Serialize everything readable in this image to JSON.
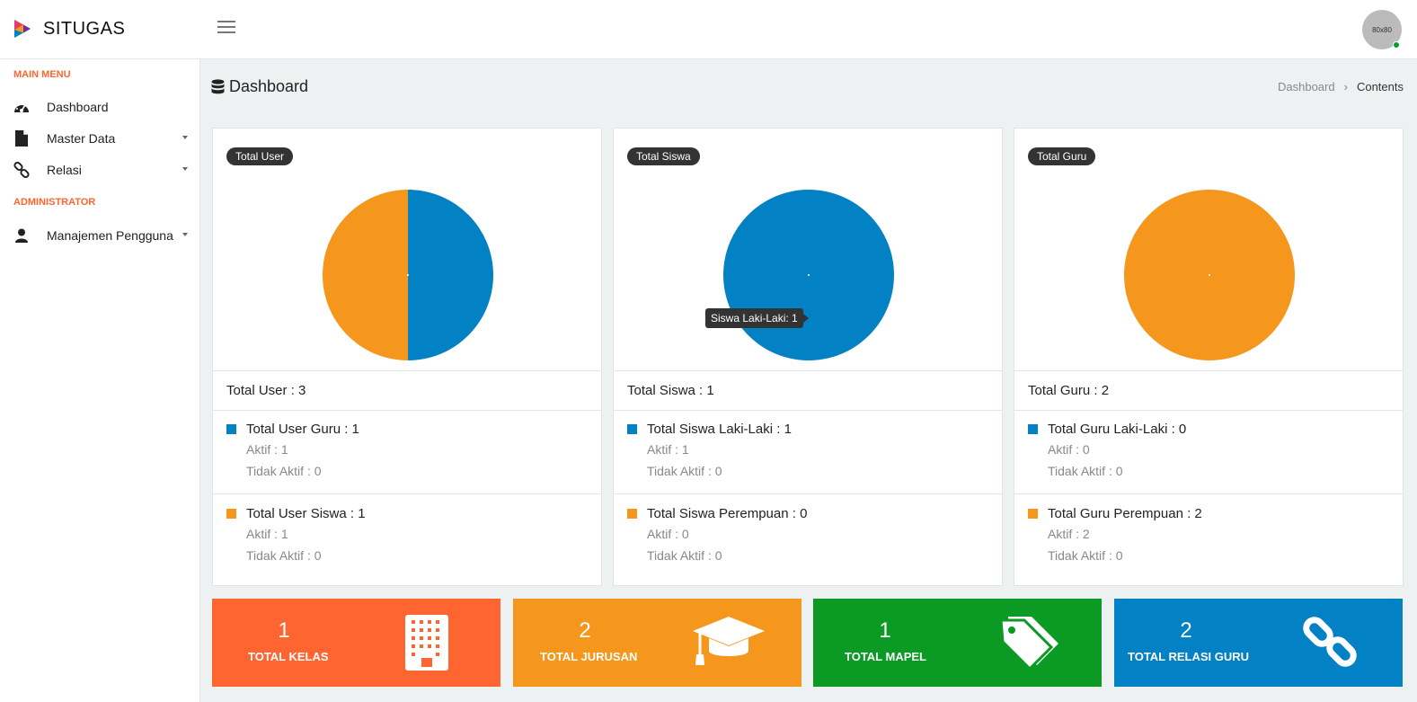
{
  "app": {
    "name": "SITUGAS"
  },
  "header": {
    "avatar_text": "80x80"
  },
  "sidebar": {
    "sections": [
      {
        "header": "MAIN MENU"
      },
      {
        "header": "ADMINISTRATOR"
      }
    ],
    "items": [
      {
        "label": "Dashboard",
        "icon": "dashboard-icon"
      },
      {
        "label": "Master Data",
        "icon": "file-icon"
      },
      {
        "label": "Relasi",
        "icon": "link-icon"
      },
      {
        "label": "Manajemen Pengguna",
        "icon": "user-icon"
      }
    ]
  },
  "page": {
    "title": "Dashboard"
  },
  "breadcrumb": {
    "items": [
      "Dashboard",
      "Contents"
    ]
  },
  "colors": {
    "blue": "#0281c4",
    "orange": "#f5971d",
    "red": "#ff6530",
    "green": "#0b9a24"
  },
  "cards": [
    {
      "pill": "Total User",
      "total": "Total User : 3",
      "groups": [
        {
          "title": "Total User Guru : 1",
          "aktif": "Aktif : 1",
          "tidak_aktif": "Tidak Aktif : 0"
        },
        {
          "title": "Total User Siswa : 1",
          "aktif": "Aktif : 1",
          "tidak_aktif": "Tidak Aktif : 0"
        }
      ]
    },
    {
      "pill": "Total Siswa",
      "total": "Total Siswa : 1",
      "tooltip": "Siswa Laki-Laki: 1",
      "groups": [
        {
          "title": "Total Siswa Laki-Laki : 1",
          "aktif": "Aktif : 1",
          "tidak_aktif": "Tidak Aktif : 0"
        },
        {
          "title": "Total Siswa Perempuan : 0",
          "aktif": "Aktif : 0",
          "tidak_aktif": "Tidak Aktif : 0"
        }
      ]
    },
    {
      "pill": "Total Guru",
      "total": "Total Guru : 2",
      "groups": [
        {
          "title": "Total Guru Laki-Laki : 0",
          "aktif": "Aktif : 0",
          "tidak_aktif": "Tidak Aktif : 0"
        },
        {
          "title": "Total Guru Perempuan : 2",
          "aktif": "Aktif : 2",
          "tidak_aktif": "Tidak Aktif : 0"
        }
      ]
    }
  ],
  "chart_data": [
    {
      "type": "pie",
      "categories": [
        "Total User Guru",
        "Total User Siswa"
      ],
      "values": [
        1,
        1
      ],
      "colors": [
        "#0281c4",
        "#f5971d"
      ]
    },
    {
      "type": "pie",
      "categories": [
        "Siswa Laki-Laki",
        "Siswa Perempuan"
      ],
      "values": [
        1,
        0
      ],
      "colors": [
        "#0281c4",
        "#f5971d"
      ]
    },
    {
      "type": "pie",
      "categories": [
        "Guru Laki-Laki",
        "Guru Perempuan"
      ],
      "values": [
        0,
        2
      ],
      "colors": [
        "#0281c4",
        "#f5971d"
      ]
    }
  ],
  "tiles": [
    {
      "value": "1",
      "label": "TOTAL KELAS",
      "icon": "building-icon",
      "color": "#ff6530"
    },
    {
      "value": "2",
      "label": "TOTAL JURUSAN",
      "icon": "graduation-cap-icon",
      "color": "#f5971d"
    },
    {
      "value": "1",
      "label": "TOTAL MAPEL",
      "icon": "tags-icon",
      "color": "#0b9a24"
    },
    {
      "value": "2",
      "label": "TOTAL RELASI GURU",
      "icon": "link-icon",
      "color": "#0281c4"
    }
  ]
}
